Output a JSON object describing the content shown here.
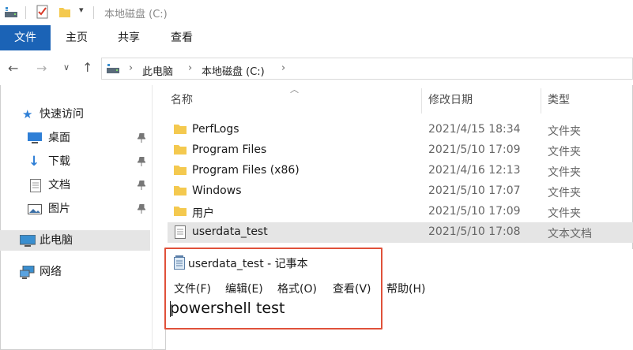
{
  "window": {
    "title": "本地磁盘 (C:)"
  },
  "ribbon": {
    "tabs": [
      {
        "label": "文件",
        "active": true
      },
      {
        "label": "主页",
        "active": false
      },
      {
        "label": "共享",
        "active": false
      },
      {
        "label": "查看",
        "active": false
      }
    ]
  },
  "address": {
    "crumbs": [
      "此电脑",
      "本地磁盘 (C:)"
    ]
  },
  "sidebar": {
    "quick_access": "快速访问",
    "items": [
      {
        "label": "桌面",
        "icon": "desktop-icon"
      },
      {
        "label": "下载",
        "icon": "download-icon"
      },
      {
        "label": "文档",
        "icon": "document-icon"
      },
      {
        "label": "图片",
        "icon": "picture-icon"
      }
    ],
    "this_pc": "此电脑",
    "network": "网络"
  },
  "columns": {
    "name": "名称",
    "date": "修改日期",
    "type": "类型"
  },
  "files": [
    {
      "name": "PerfLogs",
      "date": "2021/4/15 18:34",
      "type": "文件夹",
      "kind": "folder"
    },
    {
      "name": "Program Files",
      "date": "2021/5/10 17:09",
      "type": "文件夹",
      "kind": "folder"
    },
    {
      "name": "Program Files (x86)",
      "date": "2021/4/16 12:13",
      "type": "文件夹",
      "kind": "folder"
    },
    {
      "name": "Windows",
      "date": "2021/5/10 17:07",
      "type": "文件夹",
      "kind": "folder"
    },
    {
      "name": "用户",
      "date": "2021/5/10 17:09",
      "type": "文件夹",
      "kind": "folder"
    },
    {
      "name": "userdata_test",
      "date": "2021/5/10 17:08",
      "type": "文本文档",
      "kind": "text",
      "selected": true
    }
  ],
  "notepad": {
    "title": "userdata_test - 记事本",
    "menu": [
      "文件(F)",
      "编辑(E)",
      "格式(O)",
      "查看(V)",
      "帮助(H)"
    ],
    "content": "powershell test"
  },
  "colors": {
    "accent": "#1b63b6",
    "folder": "#f4c94f",
    "highlight": "#e0513a"
  }
}
